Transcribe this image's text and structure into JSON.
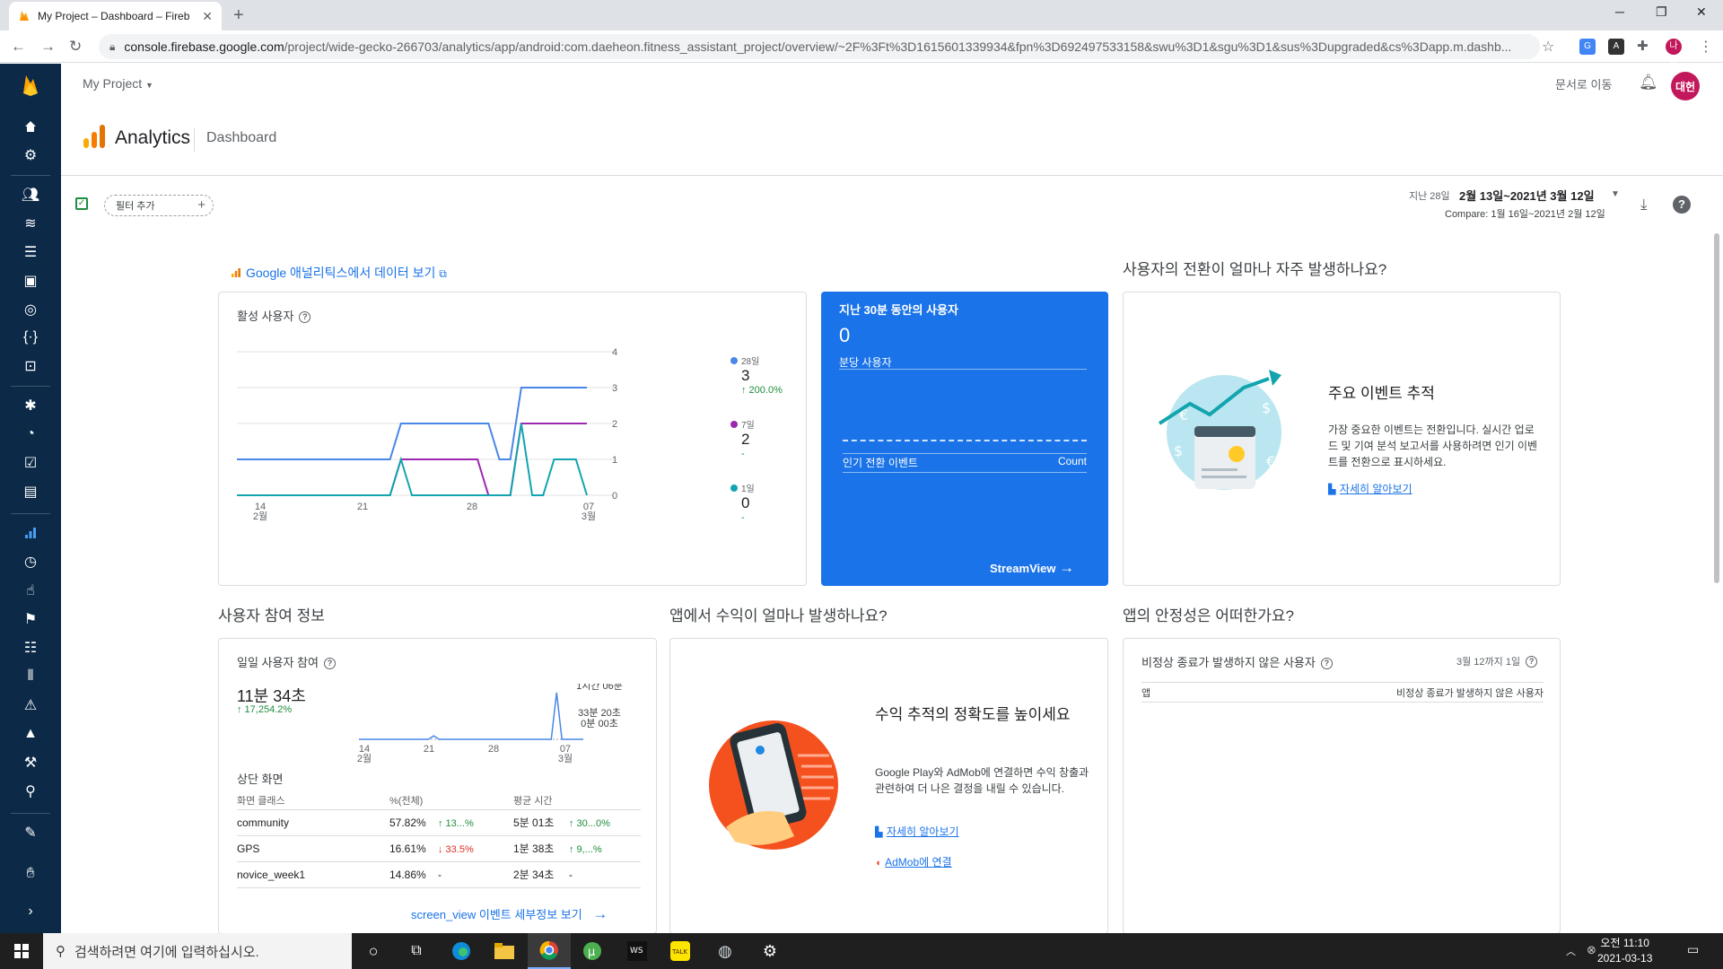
{
  "browser": {
    "tab_title": "My Project – Dashboard – Fireb",
    "tab_close": "✕",
    "new_tab": "+",
    "url_host": "console.firebase.google.com",
    "url_path": "/project/wide-gecko-266703/analytics/app/android:com.daeheon.fitness_assistant_project/overview/~2F%3Ft%3D1615601339934&fpn%3D692497533158&swu%3D1&sgu%3D1&sus%3Dupgraded&cs%3Dapp.m.dashb...",
    "profile_badge": "나다"
  },
  "header": {
    "project": "My Project",
    "docs_link": "문서로 이동",
    "avatar_text": "대헌",
    "product": "Analytics",
    "page": "Dashboard"
  },
  "filter": {
    "add_filter": "필터 추가",
    "range_label": "지난 28일",
    "range_value": "2월 13일~2021년 3월 12일",
    "compare": "Compare: 1월 16일~2021년 2월 12일"
  },
  "ga_link": "Google 애널리틱스에서 데이터 보기",
  "active_users": {
    "title": "활성 사용자",
    "legend": [
      {
        "label": "28일",
        "value": "3",
        "delta": "↑ 200.0%",
        "color": "#4a86e8"
      },
      {
        "label": "7일",
        "value": "2",
        "delta": "-",
        "color": "#9c27b0"
      },
      {
        "label": "1일",
        "value": "0",
        "delta": "-",
        "color": "#12a4af"
      }
    ]
  },
  "realtime": {
    "title": "지난 30분 동안의 사용자",
    "value": "0",
    "per_min": "분당 사용자",
    "conv_events": "인기 전환 이벤트",
    "count": "Count",
    "streamview": "StreamView"
  },
  "conversion": {
    "section": "사용자의 전환이 얼마나 자주 발생하나요?",
    "title": "주요 이벤트 추적",
    "body": "가장 중요한 이벤트는 전환입니다. 실시간 업로드 및 기여 분석 보고서를 사용하려면 인기 이벤트를 전환으로 표시하세요.",
    "link": "자세히 알아보기"
  },
  "engagement": {
    "section": "사용자 참여 정보",
    "title": "일일 사용자 참여",
    "value": "11분 34초",
    "delta": "↑ 17,254.2%",
    "top_screens": "상단 화면",
    "col_class": "화면 클래스",
    "col_pct": "%(전체)",
    "col_avg": "평균 시간",
    "rows": [
      {
        "name": "community",
        "pct": "57.82%",
        "pct_delta": "↑ 13...%",
        "pct_dir": "up",
        "avg": "5분 01초",
        "avg_delta": "↑ 30...0%",
        "avg_dir": "up"
      },
      {
        "name": "GPS",
        "pct": "16.61%",
        "pct_delta": "↓ 33.5%",
        "pct_dir": "dn",
        "avg": "1분 38초",
        "avg_delta": "↑ 9,...%",
        "avg_dir": "up"
      },
      {
        "name": "novice_week1",
        "pct": "14.86%",
        "pct_delta": "-",
        "pct_dir": "none",
        "avg": "2분 34초",
        "avg_delta": "-",
        "avg_dir": "none"
      }
    ],
    "footer_link": "screen_view 이벤트 세부정보 보기"
  },
  "revenue": {
    "section": "앱에서 수익이 얼마나 발생하나요?",
    "title": "수익 추적의 정확도를 높이세요",
    "body": "Google Play와 AdMob에 연결하면 수익 창출과 관련하여 더 나은 결정을 내릴 수 있습니다.",
    "link1": "자세히 알아보기",
    "link2": "AdMob에 연결"
  },
  "stability": {
    "section": "앱의 안정성은 어떠한가요?",
    "title": "비정상 종료가 발생하지 않은 사용자",
    "date": "3월 12까지 1일",
    "col_app": "앱",
    "col_users": "비정상 종료가 발생하지 않은 사용자"
  },
  "taskbar": {
    "search": "검색하려면 여기에 입력하십시오.",
    "time": "오전 11:10",
    "date": "2021-03-13"
  },
  "chart_data": [
    {
      "type": "line",
      "title": "활성 사용자",
      "x_ticks": [
        "14\n2월",
        "21",
        "28",
        "07\n3월"
      ],
      "x": [
        "2/13",
        "2/14",
        "2/15",
        "2/16",
        "2/17",
        "2/18",
        "2/19",
        "2/20",
        "2/21",
        "2/22",
        "2/23",
        "2/24",
        "2/25",
        "2/26",
        "2/27",
        "2/28",
        "3/1",
        "3/2",
        "3/3",
        "3/4",
        "3/5",
        "3/6",
        "3/7",
        "3/8",
        "3/9",
        "3/10",
        "3/11",
        "3/12"
      ],
      "ylim": [
        0,
        4
      ],
      "y_ticks": [
        0,
        1,
        2,
        3,
        4
      ],
      "series": [
        {
          "name": "28일",
          "values": [
            1,
            1,
            1,
            1,
            1,
            1,
            1,
            1,
            1,
            1,
            1,
            1,
            1,
            1,
            1,
            2,
            2,
            2,
            2,
            2,
            2,
            2,
            2,
            2,
            1,
            1,
            3,
            3,
            3,
            3,
            3,
            3,
            3
          ]
        },
        {
          "name": "7일",
          "values": [
            0,
            0,
            0,
            0,
            0,
            0,
            0,
            0,
            0,
            0,
            0,
            0,
            0,
            0,
            0,
            1,
            1,
            1,
            1,
            1,
            1,
            1,
            1,
            0,
            0,
            0,
            2,
            2,
            2,
            2,
            2,
            2,
            2
          ]
        },
        {
          "name": "1일",
          "values": [
            0,
            0,
            0,
            0,
            0,
            0,
            0,
            0,
            0,
            0,
            0,
            0,
            0,
            0,
            0,
            1,
            0,
            0,
            0,
            0,
            0,
            0,
            0,
            0,
            0,
            0,
            2,
            0,
            0,
            1,
            1,
            1,
            0
          ]
        }
      ]
    },
    {
      "type": "line",
      "title": "일일 사용자 참여",
      "x_ticks": [
        "14\n2월",
        "21",
        "28",
        "07\n3월"
      ],
      "y_labels": [
        "1시간 06분",
        "33분 20초",
        "0분 00초"
      ],
      "series": [
        {
          "name": "engagement",
          "values": [
            0,
            0,
            0,
            0,
            0,
            0,
            0,
            0,
            0,
            0,
            0,
            0,
            0,
            0,
            3,
            0,
            0,
            0,
            0,
            0,
            0,
            0,
            0,
            0,
            0,
            0,
            0,
            0,
            0,
            0,
            0,
            0,
            0,
            0,
            0,
            0,
            0,
            40,
            0,
            0,
            0,
            0,
            0
          ]
        }
      ]
    }
  ]
}
